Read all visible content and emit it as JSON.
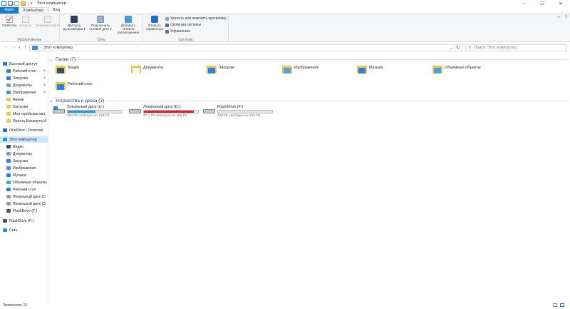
{
  "window": {
    "title": "Этот компьютер",
    "controls": {
      "minimize": "–",
      "maximize": "☐",
      "close": "✕"
    }
  },
  "ribbon": {
    "tabs": [
      {
        "label": "Файл"
      },
      {
        "label": "Компьютер"
      },
      {
        "label": "Вид"
      }
    ],
    "groups": {
      "location": {
        "label": "Расположение",
        "buttons": [
          {
            "label": "Свойства",
            "icon": "check-icon"
          },
          {
            "label": "Открыть",
            "icon": "open-icon"
          },
          {
            "label": "Переименовать",
            "icon": "rename-icon"
          }
        ]
      },
      "network": {
        "label": "Сеть",
        "buttons": [
          {
            "label": "Доступ к мультимедиа ▾",
            "icon": "media-icon"
          },
          {
            "label": "Подключить сетевой диск ▾",
            "icon": "network-drive-icon"
          },
          {
            "label": "Добавить сетевое расположение",
            "icon": "network-location-icon"
          }
        ]
      },
      "system": {
        "label": "Система",
        "open_settings": "Открыть параметры",
        "items": [
          {
            "label": "Удалить или изменить программу"
          },
          {
            "label": "Свойства системы"
          },
          {
            "label": "Управление"
          }
        ]
      }
    }
  },
  "address": {
    "breadcrumb": "Этот компьютер",
    "search_placeholder": "Поиск: Этот компьютер"
  },
  "nav": {
    "items": [
      {
        "label": "Быстрый доступ",
        "icon": "star-icon",
        "color": "#2f7fd6",
        "pinned": false
      },
      {
        "label": "Рабочий стол",
        "icon": "desktop-icon",
        "color": "#2f7fd6",
        "pinned": true
      },
      {
        "label": "Загрузки",
        "icon": "download-icon",
        "color": "#2f7fd6",
        "pinned": true
      },
      {
        "label": "Документы",
        "icon": "documents-icon",
        "color": "#8a9ab0",
        "pinned": true
      },
      {
        "label": "Изображения",
        "icon": "pictures-icon",
        "color": "#4a90d9",
        "pinned": true
      },
      {
        "label": "Аниме",
        "icon": "folder-icon",
        "color": "#e8c55a",
        "pinned": false
      },
      {
        "label": "Загрузки",
        "icon": "folder-icon",
        "color": "#e8c55a",
        "pinned": false
      },
      {
        "label": "Моя геройская ака",
        "icon": "folder-icon",
        "color": "#e8c55a",
        "pinned": false
      },
      {
        "label": "Ярость Бахамута И",
        "icon": "folder-icon",
        "color": "#e8c55a",
        "pinned": false
      },
      {
        "label": "OneDrive - Personal",
        "icon": "cloud-icon",
        "color": "#1f6fc4",
        "pinned": false
      },
      {
        "label": "Этот компьютер",
        "icon": "computer-icon",
        "color": "#3a8ed8",
        "pinned": false
      },
      {
        "label": "Видео",
        "icon": "video-icon",
        "color": "#3c4a5a",
        "pinned": false
      },
      {
        "label": "Документы",
        "icon": "documents-icon",
        "color": "#8a9ab0",
        "pinned": false
      },
      {
        "label": "Загрузки",
        "icon": "download-icon",
        "color": "#2f7fd6",
        "pinned": false
      },
      {
        "label": "Изображения",
        "icon": "pictures-icon",
        "color": "#4a90d9",
        "pinned": false
      },
      {
        "label": "Музыка",
        "icon": "music-icon",
        "color": "#2f7fd6",
        "pinned": false
      },
      {
        "label": "Объемные объекты",
        "icon": "3d-objects-icon",
        "color": "#4aa3e6",
        "pinned": false
      },
      {
        "label": "Рабочий стол",
        "icon": "desktop-icon",
        "color": "#2f7fd6",
        "pinned": false
      },
      {
        "label": "Локальный диск (C",
        "icon": "drive-icon",
        "color": "#9a9a9a",
        "pinned": false
      },
      {
        "label": "Локальный диск (D",
        "icon": "drive-icon",
        "color": "#9a9a9a",
        "pinned": false
      },
      {
        "label": "FlashDrive (F:)",
        "icon": "usb-drive-icon",
        "color": "#555555",
        "pinned": false
      },
      {
        "label": "FlashDrive (F:)",
        "icon": "usb-drive-icon",
        "color": "#555555",
        "pinned": false
      },
      {
        "label": "Сеть",
        "icon": "network-icon",
        "color": "#3a8ed8",
        "pinned": false
      }
    ]
  },
  "folders": {
    "header": "Папки (7)",
    "items": [
      {
        "label": "Видео",
        "icon": "video-folder-icon",
        "accent": "#3c4a5a"
      },
      {
        "label": "Документы",
        "icon": "documents-folder-icon",
        "accent": "#f4f4f4"
      },
      {
        "label": "Загрузки",
        "icon": "downloads-folder-icon",
        "accent": "#2f7fd6"
      },
      {
        "label": "Изображения",
        "icon": "pictures-folder-icon",
        "accent": "#5aa0e0"
      },
      {
        "label": "Музыка",
        "icon": "music-folder-icon",
        "accent": "#2f7fd6"
      },
      {
        "label": "Объемные объекты",
        "icon": "3d-objects-folder-icon",
        "accent": "#4aa3e6"
      },
      {
        "label": "Рабочий стол",
        "icon": "desktop-folder-icon",
        "accent": "#2f7fd6"
      }
    ]
  },
  "devices": {
    "header": "Устройства и диски (3)",
    "items": [
      {
        "label": "Локальный диск (C:)",
        "free_text": "110 ГБ свободно из 223 ГБ",
        "used_fraction": 0.51,
        "bar_color": "#26a0da",
        "icon": "windows-drive-icon"
      },
      {
        "label": "Локальный диск (D:)",
        "free_text": "37,1 ГБ свободно из 465 ГБ",
        "used_fraction": 0.92,
        "bar_color": "#da2626",
        "icon": "drive-icon"
      },
      {
        "label": "FlashDrive (F:)",
        "free_text": "225 ГБ свободно из 225 ГБ",
        "used_fraction": 0.0,
        "bar_color": "#26a0da",
        "icon": "usb-drive-icon"
      }
    ]
  },
  "status": {
    "items_count": "Элементов: 10"
  }
}
